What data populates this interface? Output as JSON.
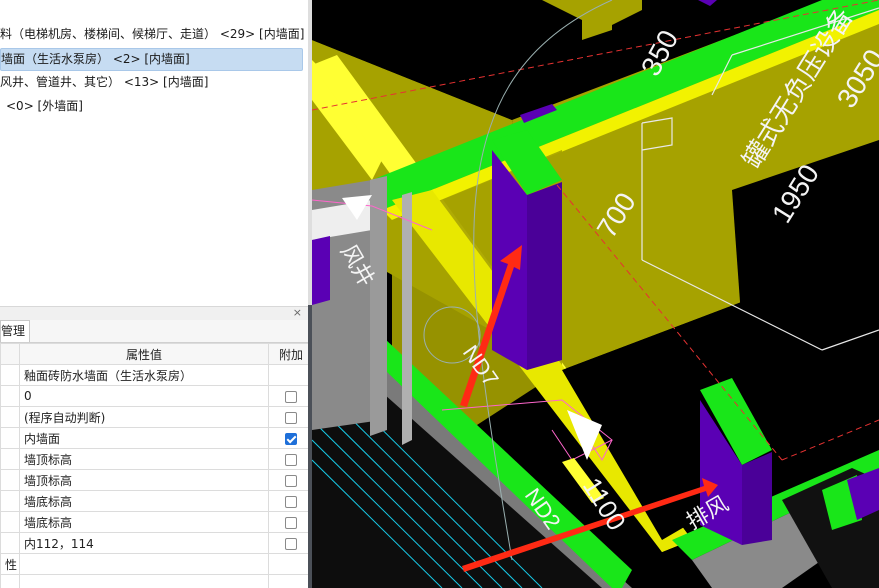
{
  "tree": {
    "items": [
      {
        "text": "料（电梯机房、楼梯间、候梯厅、走道） <29> [内墙面]",
        "selected": false
      },
      {
        "text": "墙面（生活水泵房） <2> [内墙面]",
        "selected": true
      },
      {
        "text": "风井、管道井、其它） <13> [内墙面]",
        "selected": false
      },
      {
        "text": "<0> [外墙面]",
        "selected": false
      }
    ]
  },
  "panel": {
    "close_glyph": "×",
    "tab_label": "管理"
  },
  "properties": {
    "header_value": "属性值",
    "header_extra": "附加",
    "rows": [
      {
        "value": "釉面砖防水墙面（生活水泵房）",
        "checkbox": false,
        "checked": false
      },
      {
        "value": "0",
        "checkbox": true,
        "checked": false
      },
      {
        "value": "(程序自动判断)",
        "checkbox": true,
        "checked": false
      },
      {
        "value": "内墙面",
        "checkbox": true,
        "checked": true
      },
      {
        "value": "墙顶标高",
        "checkbox": true,
        "checked": false
      },
      {
        "value": "墙顶标高",
        "checkbox": true,
        "checked": false
      },
      {
        "value": "墙底标高",
        "checkbox": true,
        "checked": false
      },
      {
        "value": "墙底标高",
        "checkbox": true,
        "checked": false
      },
      {
        "value": "内112，114",
        "checkbox": true,
        "checked": false
      },
      {
        "name": "性",
        "value": "",
        "checkbox": false,
        "checked": false
      },
      {
        "value": "",
        "checkbox": false,
        "checked": false
      }
    ]
  },
  "viewport": {
    "labels": {
      "dim_350": "350",
      "dim_3050": "3050",
      "dim_700": "700",
      "dim_1950": "1950",
      "dim_1100": "1100",
      "equipment": "罐式无负压设备",
      "door_nd7": "ND7",
      "door_nd2": "ND2",
      "shaft_left": "风井",
      "shaft_bottom": "排风"
    },
    "colors": {
      "floor_olive": "#a6a200",
      "wall_yellow": "#ffff33",
      "wall_green": "#19e619",
      "column_purple": "#5a00b4",
      "arrow_red": "#ff2a14",
      "background": "#000000",
      "wall_gray": "#8a8a8a"
    }
  }
}
